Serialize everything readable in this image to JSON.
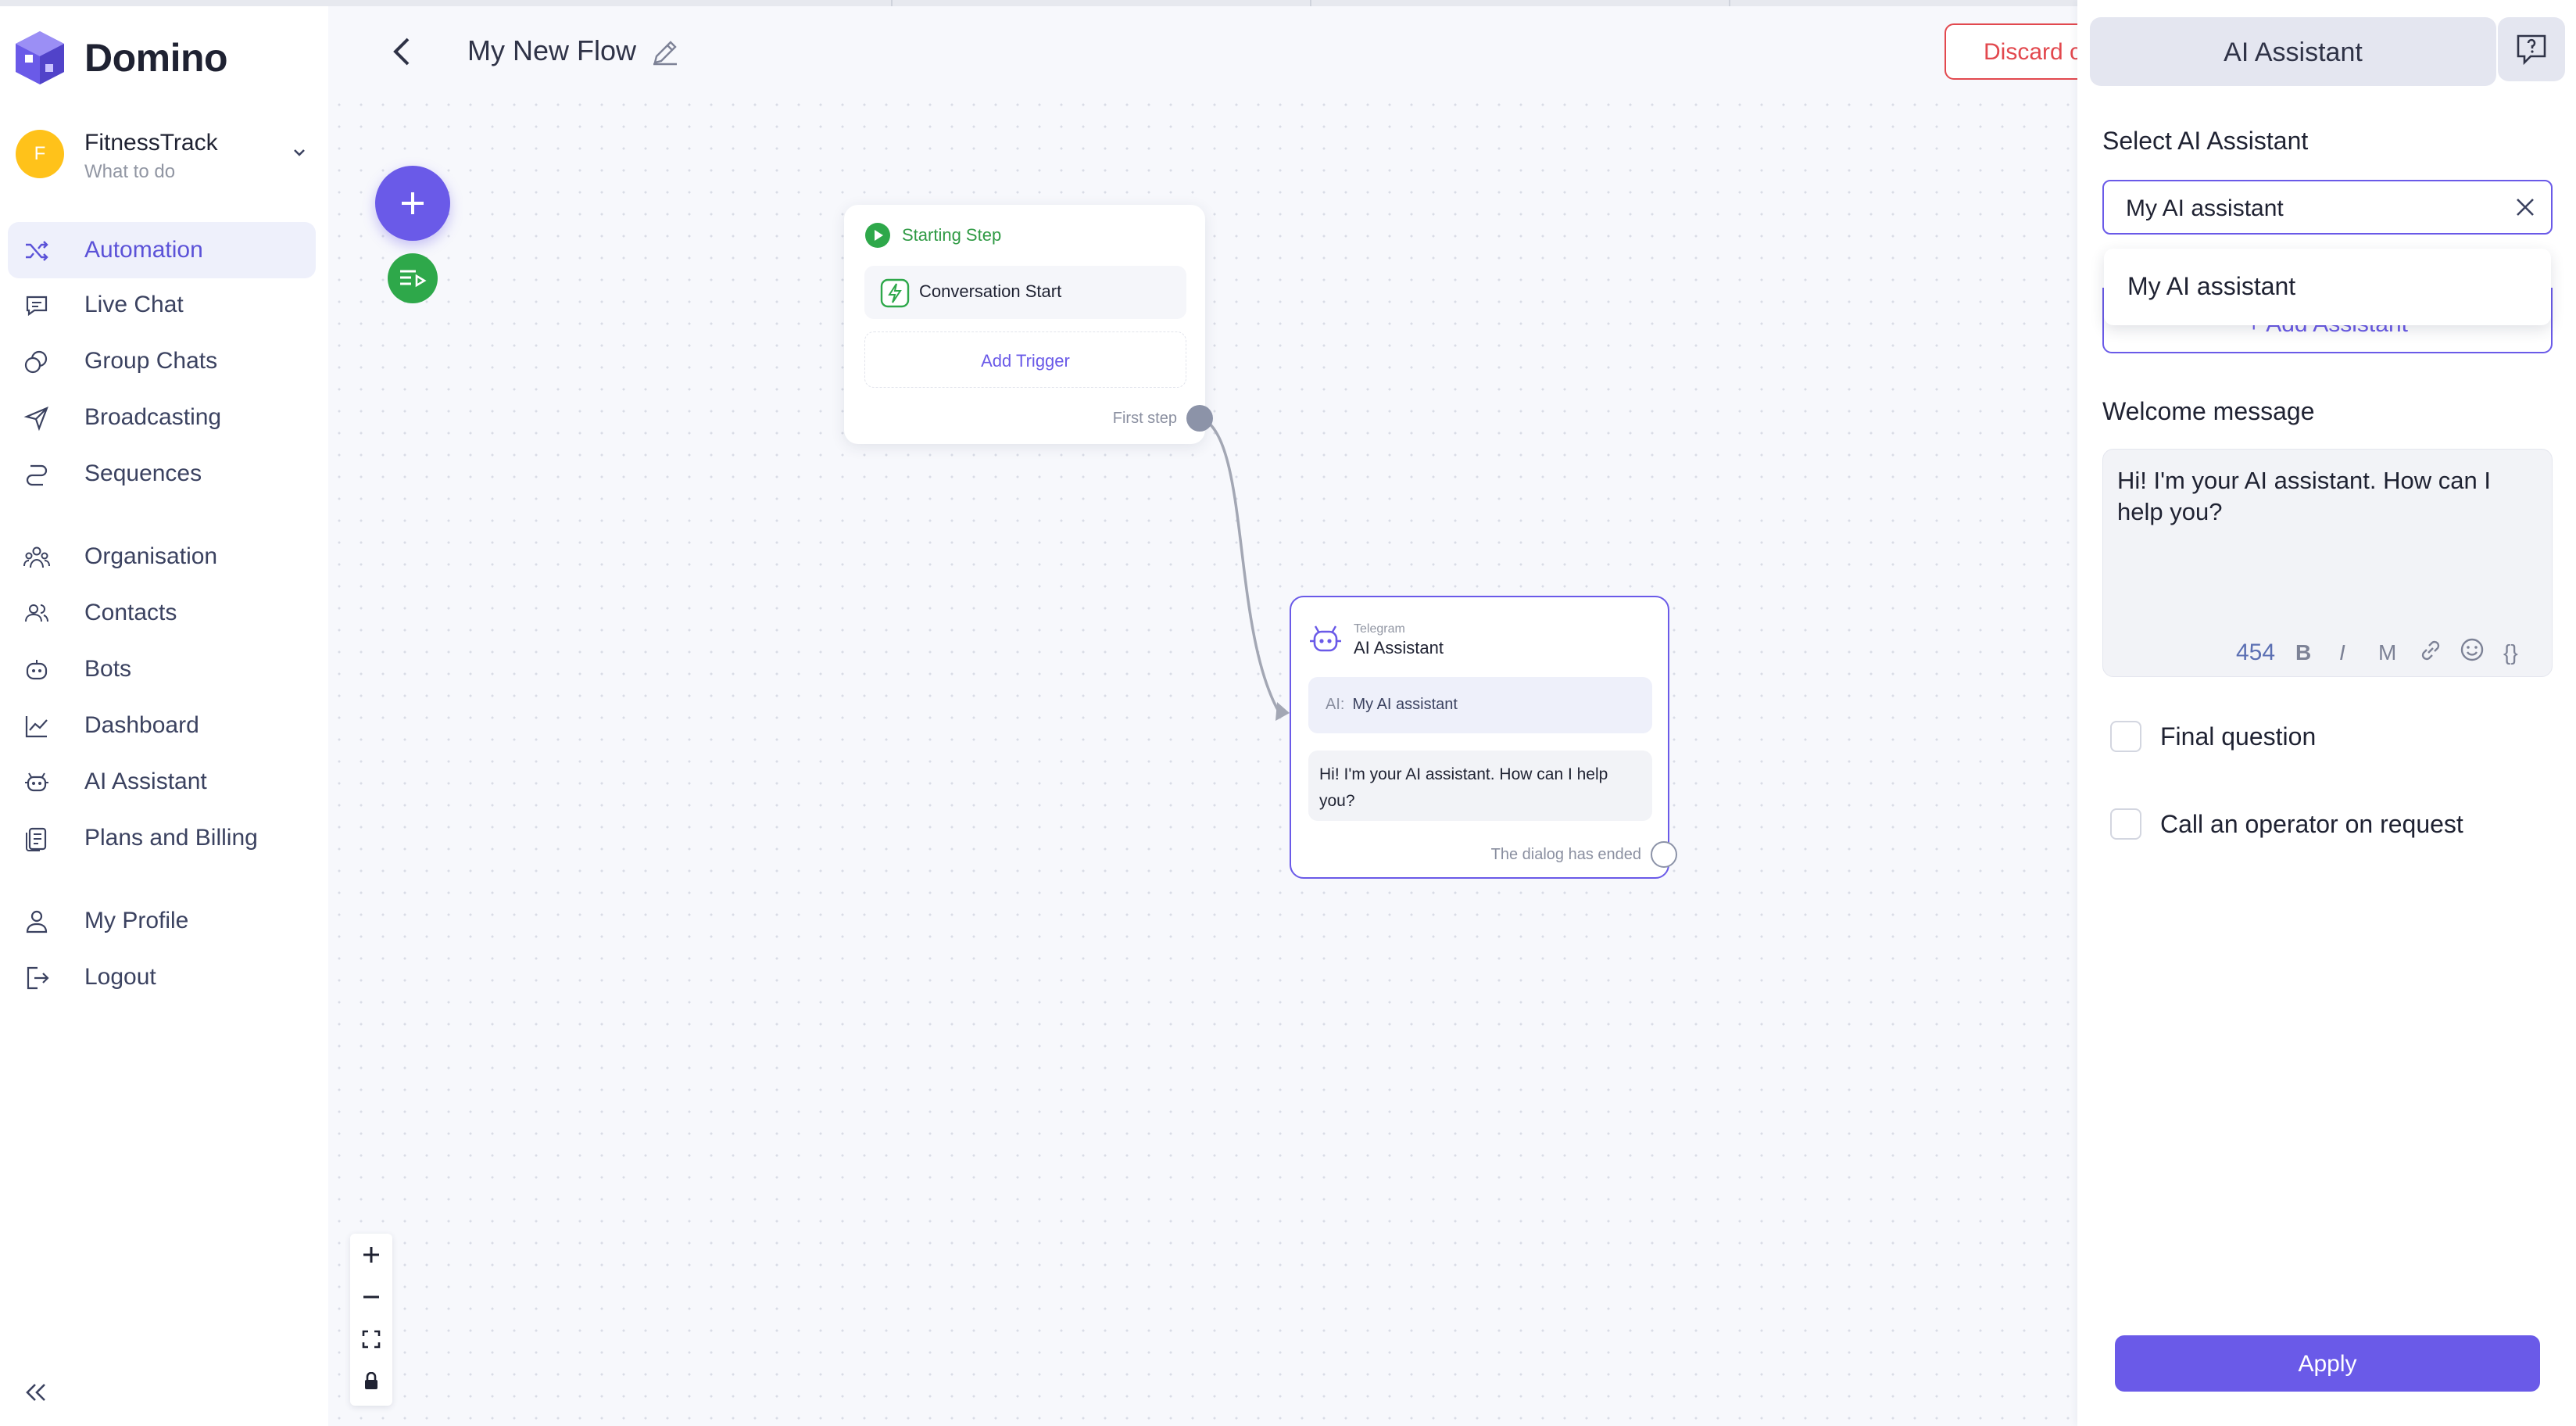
{
  "app": {
    "name": "Domino"
  },
  "org": {
    "avatar_letter": "F",
    "name": "FitnessTrack",
    "subtitle": "What to do"
  },
  "nav": {
    "items": [
      {
        "label": "Automation",
        "icon": "shuffle-icon",
        "active": true
      },
      {
        "label": "Live Chat",
        "icon": "chat-icon"
      },
      {
        "label": "Group Chats",
        "icon": "group-chat-icon"
      },
      {
        "label": "Broadcasting",
        "icon": "send-icon"
      },
      {
        "label": "Sequences",
        "icon": "sequence-icon"
      },
      {
        "label": "Organisation",
        "icon": "organisation-icon"
      },
      {
        "label": "Contacts",
        "icon": "contacts-icon"
      },
      {
        "label": "Bots",
        "icon": "bot-icon"
      },
      {
        "label": "Dashboard",
        "icon": "chart-icon"
      },
      {
        "label": "AI Assistant",
        "icon": "ai-icon"
      },
      {
        "label": "Plans and Billing",
        "icon": "billing-icon"
      },
      {
        "label": "My Profile",
        "icon": "user-icon"
      },
      {
        "label": "Logout",
        "icon": "logout-icon"
      }
    ]
  },
  "header": {
    "flow_title": "My New Flow",
    "discard_label": "Discard c"
  },
  "flow": {
    "start_node": {
      "title": "Starting Step",
      "trigger": "Conversation Start",
      "add_trigger": "Add Trigger",
      "first_step": "First step"
    },
    "ai_node": {
      "channel": "Telegram",
      "title": "AI Assistant",
      "ai_prefix": "AI:",
      "ai_name": "My AI assistant",
      "message": "Hi! I'm your AI assistant. How can I help you?",
      "end_label": "The dialog has ended"
    }
  },
  "panel": {
    "tab_label": "AI Assistant",
    "select_label": "Select AI Assistant",
    "select_value": "My AI assistant",
    "dropdown_option": "My AI assistant",
    "add_assistant": "+ Add Assistant",
    "welcome_label": "Welcome message",
    "welcome_text": "Hi! I'm your AI assistant. How can I help you?",
    "char_count": "454",
    "toolbar": {
      "bold": "B",
      "italic": "I",
      "markdown": "M",
      "braces": "{}"
    },
    "final_question": "Final question",
    "call_operator": "Call an operator on request",
    "apply": "Apply"
  },
  "colors": {
    "accent": "#6a5ae8",
    "success": "#2ea84a",
    "danger": "#e2484e"
  }
}
